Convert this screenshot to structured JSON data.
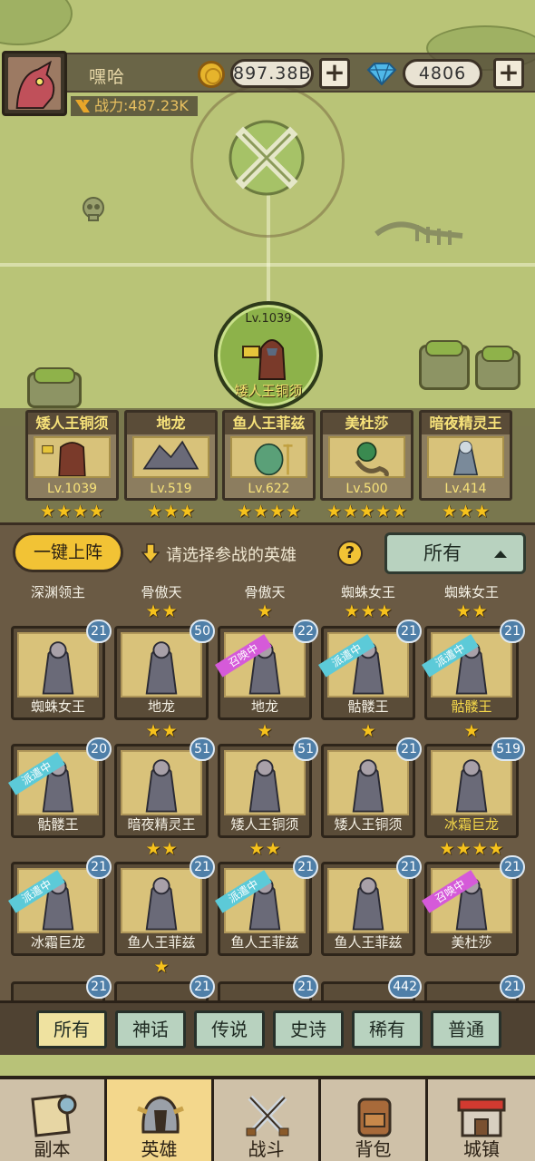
{
  "player": {
    "name": "嘿哈",
    "gold": "897.38B",
    "gems": "4806",
    "power_label": "战力:487.23K"
  },
  "selected_hero": {
    "level": "Lv.1039",
    "name": "矮人王铜须"
  },
  "team": [
    {
      "name": "矮人王铜须",
      "level": "Lv.1039",
      "stars": 4
    },
    {
      "name": "地龙",
      "level": "Lv.519",
      "stars": 3
    },
    {
      "name": "鱼人王菲兹",
      "level": "Lv.622",
      "stars": 4
    },
    {
      "name": "美杜莎",
      "level": "Lv.500",
      "stars": 5
    },
    {
      "name": "暗夜精灵王",
      "level": "Lv.414",
      "stars": 3
    }
  ],
  "actions": {
    "deploy_label": "一键上阵",
    "prompt": "请选择参战的英雄",
    "help": "?",
    "filter_value": "所有"
  },
  "grid_top_row": [
    {
      "name": "深渊领主",
      "stars": 0
    },
    {
      "name": "骨傲天",
      "stars": 2
    },
    {
      "name": "骨傲天",
      "stars": 1
    },
    {
      "name": "蜘蛛女王",
      "stars": 3
    },
    {
      "name": "蜘蛛女王",
      "stars": 2
    }
  ],
  "grid": [
    {
      "name": "蜘蛛女王",
      "level": "21",
      "stars": 0,
      "tag": "",
      "gold": false
    },
    {
      "name": "地龙",
      "level": "50",
      "stars": 2,
      "tag": "",
      "gold": false
    },
    {
      "name": "地龙",
      "level": "22",
      "stars": 1,
      "tag": "召唤中",
      "gold": false
    },
    {
      "name": "骷髅王",
      "level": "21",
      "stars": 1,
      "tag": "派遣中",
      "gold": false
    },
    {
      "name": "骷髅王",
      "level": "21",
      "stars": 1,
      "tag": "派遣中",
      "gold": true
    },
    {
      "name": "骷髅王",
      "level": "20",
      "stars": 0,
      "tag": "派遣中",
      "gold": false
    },
    {
      "name": "暗夜精灵王",
      "level": "51",
      "stars": 2,
      "tag": "",
      "gold": false
    },
    {
      "name": "矮人王铜须",
      "level": "51",
      "stars": 2,
      "tag": "",
      "gold": false
    },
    {
      "name": "矮人王铜须",
      "level": "21",
      "stars": 0,
      "tag": "",
      "gold": false
    },
    {
      "name": "冰霜巨龙",
      "level": "519",
      "stars": 4,
      "tag": "",
      "gold": true
    },
    {
      "name": "冰霜巨龙",
      "level": "21",
      "stars": 0,
      "tag": "派遣中",
      "gold": false
    },
    {
      "name": "鱼人王菲兹",
      "level": "21",
      "stars": 1,
      "tag": "",
      "gold": false
    },
    {
      "name": "鱼人王菲兹",
      "level": "21",
      "stars": 0,
      "tag": "派遣中",
      "gold": false
    },
    {
      "name": "鱼人王菲兹",
      "level": "21",
      "stars": 0,
      "tag": "",
      "gold": false
    },
    {
      "name": "美杜莎",
      "level": "21",
      "stars": 0,
      "tag": "召唤中",
      "gold": false
    }
  ],
  "grid_partial_levels": [
    "21",
    "21",
    "21",
    "442",
    "21"
  ],
  "rarity_tabs": [
    "所有",
    "神话",
    "传说",
    "史诗",
    "稀有",
    "普通"
  ],
  "nav": [
    "副本",
    "英雄",
    "战斗",
    "背包",
    "城镇"
  ],
  "colors": {
    "accent_gold": "#f2c335",
    "level_badge": "#4f7fa8",
    "dispatch_tag": "#5ccad8",
    "summon_tag": "#d55ad9",
    "star": "#f6c21c"
  }
}
